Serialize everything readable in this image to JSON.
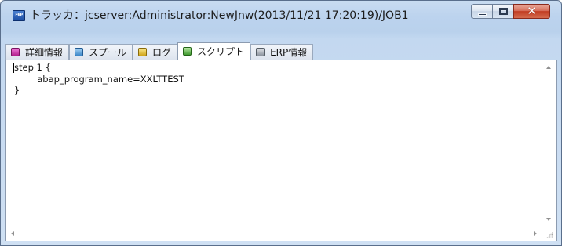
{
  "window": {
    "icon_text": "ERP",
    "title": "トラッカ：jcserver:Administrator:NewJnw(2013/11/21 17:20:19)/JOB1",
    "buttons": {
      "close_glyph": "✕"
    }
  },
  "tabs": [
    {
      "label": "詳細情報",
      "icon": "magenta-page-icon",
      "color": "#c13aa0",
      "active": false
    },
    {
      "label": "スプール",
      "icon": "blue-page-icon",
      "color": "#3a86c8",
      "active": false
    },
    {
      "label": "ログ",
      "icon": "yellow-page-icon",
      "color": "#d0a51a",
      "active": false
    },
    {
      "label": "スクリプト",
      "icon": "green-page-icon",
      "color": "#3f9a2f",
      "active": true
    },
    {
      "label": "ERP情報",
      "icon": "gray-page-icon",
      "color": "#8b939d",
      "active": false
    }
  ],
  "script": {
    "lines": [
      "step 1 {",
      "        abap_program_name=XXLTTEST",
      "}"
    ]
  }
}
